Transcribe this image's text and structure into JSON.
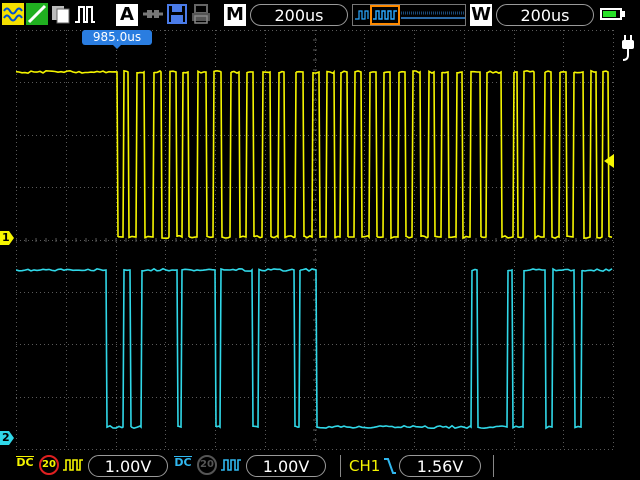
{
  "toolbar": {
    "mode_label": "M",
    "timebase_value": "200us",
    "window_label": "W",
    "window_timebase": "200us",
    "trigger_time_marker": "985.0us"
  },
  "channels": {
    "ch1_marker": "1",
    "ch2_marker": "2",
    "ch1_coupling": "DC",
    "ch1_bw_limit": "20",
    "ch1_scale": "1.00V",
    "ch2_coupling": "DC",
    "ch2_bw_limit": "20",
    "ch2_scale": "1.00V"
  },
  "trigger": {
    "source": "CH1",
    "level": "1.56V",
    "slope": "falling"
  },
  "battery_level": 0.8,
  "colors": {
    "ch1": "#f5f500",
    "ch2": "#30d8e8",
    "grid": "#5a5a5a",
    "marker_box": "#2a7de0"
  },
  "icon_names": [
    "run-mode-icon",
    "measure-icon",
    "math-icon",
    "acquire-icon",
    "auto-icon",
    "link-icon",
    "save-icon",
    "print-icon",
    "power-plug-icon"
  ]
}
